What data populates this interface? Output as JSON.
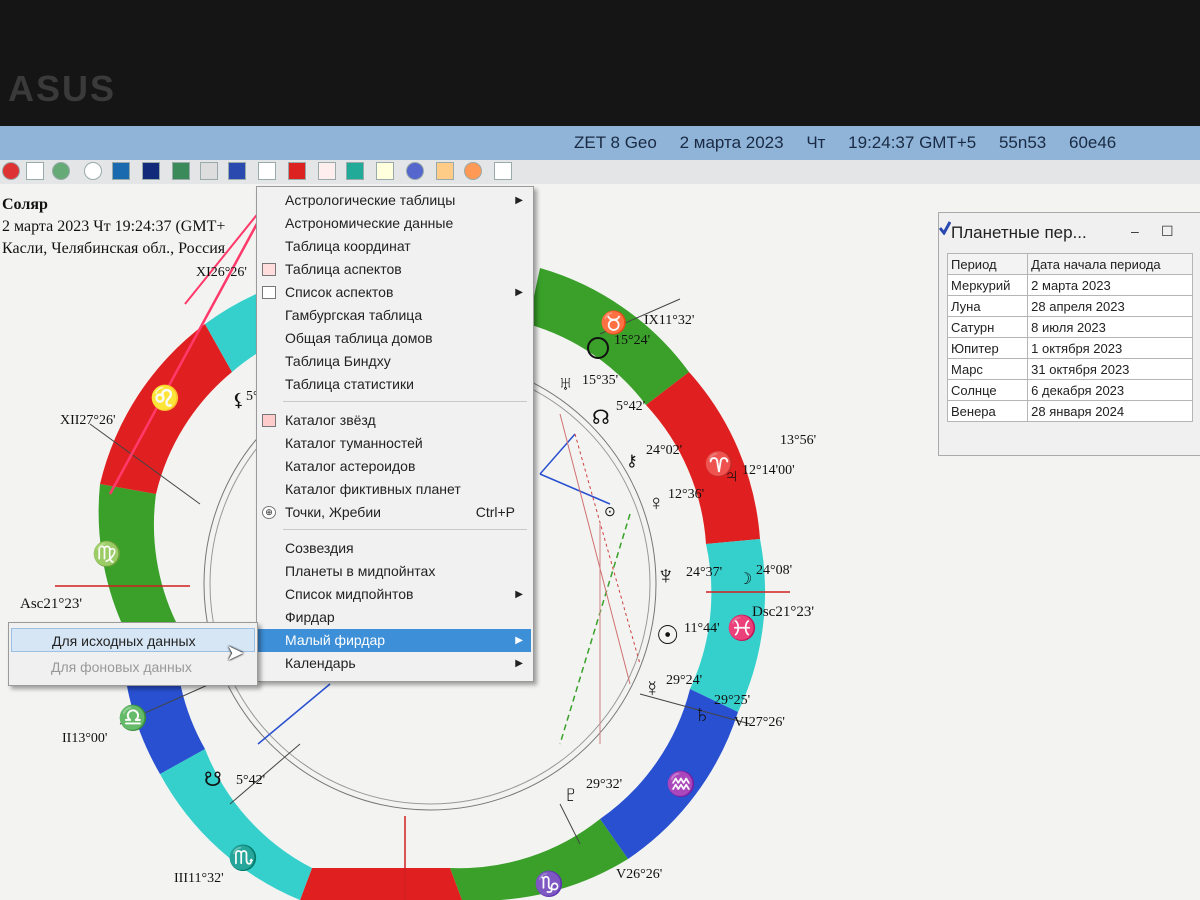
{
  "bezel": {
    "logo": "ASUS"
  },
  "titlebar": {
    "app": "ZET 8 Geo",
    "date": "2 марта 2023",
    "weekday": "Чт",
    "time": "19:24:37 GMT+5",
    "lat": "55n53",
    "lon": "60e46"
  },
  "info": {
    "title": "Соляр",
    "date_line": "2 марта 2023   Чт   19:24:37 (GMT+",
    "place": "Касли, Челябинская обл., Россия"
  },
  "menu": {
    "items": [
      {
        "label": "Астрологические таблицы",
        "submenu": true
      },
      {
        "label": "Астрономические данные"
      },
      {
        "label": "Таблица координат"
      },
      {
        "label": "Таблица аспектов",
        "icon": "aspect-table-icon"
      },
      {
        "label": "Список аспектов",
        "submenu": true,
        "icon": "list-icon"
      },
      {
        "label": "Гамбургская таблица"
      },
      {
        "label": "Общая таблица домов"
      },
      {
        "label": "Таблица Биндху"
      },
      {
        "label": "Таблица статистики"
      },
      {
        "label": "Каталог звёзд",
        "icon": "star-catalog-icon"
      },
      {
        "label": "Каталог туманностей"
      },
      {
        "label": "Каталог астероидов"
      },
      {
        "label": "Каталог фиктивных планет"
      },
      {
        "label": "Точки, Жребии",
        "shortcut": "Ctrl+P",
        "icon": "points-icon"
      },
      {
        "label": "Созвездия"
      },
      {
        "label": "Планеты в мидпойнтах"
      },
      {
        "label": "Список мидпойнтов",
        "submenu": true
      },
      {
        "label": "Фирдар"
      },
      {
        "label": "Малый фирдар",
        "submenu": true,
        "highlighted": true
      },
      {
        "label": "Календарь",
        "submenu": true
      }
    ]
  },
  "submenu": {
    "items": [
      {
        "label": "Для исходных данных",
        "highlighted": true
      },
      {
        "label": "Для фоновых данных",
        "disabled": true
      }
    ]
  },
  "periods_window": {
    "title": "Планетные пер...",
    "headers": [
      "Период",
      "Дата начала периода"
    ],
    "rows": [
      [
        "Меркурий",
        "2 марта 2023"
      ],
      [
        "Луна",
        "28 апреля 2023"
      ],
      [
        "Сатурн",
        "8 июля 2023"
      ],
      [
        "Юпитер",
        "1 октября 2023"
      ],
      [
        "Марс",
        "31 октября 2023"
      ],
      [
        "Солнце",
        "6 декабря 2023"
      ],
      [
        "Венера",
        "28 января 2024"
      ]
    ]
  },
  "chart_labels": {
    "asc": "Asc21°23'",
    "dsc": "Dsc21°23'",
    "h2": "II13°00'",
    "h3": "III11°32'",
    "h6": "VI27°26'",
    "h5": "V26°26'",
    "h9": "IX11°32'",
    "h11": "XI26°26'",
    "h12": "XII27°26'",
    "uranus": "15°35'",
    "node_n": "5°42'",
    "node_s": "5°42'",
    "chiron_north": "24°02'",
    "pluto_asteroid": "13°56'",
    "jupiter": "12°14'00'",
    "venus": "12°36'",
    "neptune": "24°37'",
    "moon_like": "24°08'",
    "sun": "11°44'",
    "mercury": "29°24'",
    "saturn": "29°25'",
    "pluto": "29°32'",
    "moon": "15°24'",
    "lilith": "5°"
  },
  "colors": {
    "fire": "#e02020",
    "earth": "#3aa02a",
    "air": "#2850d0",
    "water": "#35d0cc",
    "highlight": "#3d8fd8",
    "titlebar": "#8fb4d8"
  }
}
